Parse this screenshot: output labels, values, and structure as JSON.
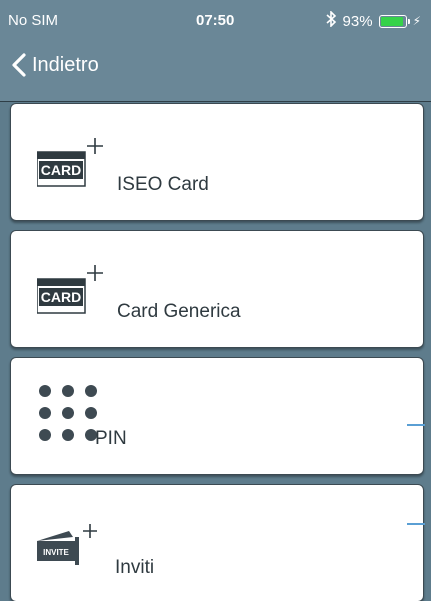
{
  "status_bar": {
    "carrier": "No SIM",
    "time": "07:50",
    "battery_percent": "93%",
    "battery_level": 0.93,
    "colors": {
      "battery": "#35d24a"
    }
  },
  "nav": {
    "back_label": "Indietro"
  },
  "items": [
    {
      "label": "ISEO Card",
      "icon": "card-plus-icon",
      "icon_text": "CARD"
    },
    {
      "label": "Card Generica",
      "icon": "card-plus-icon",
      "icon_text": "CARD"
    },
    {
      "label": "PIN",
      "icon": "keypad-dots-icon"
    },
    {
      "label": "Inviti",
      "icon": "invite-plus-icon",
      "icon_text": "INVITE"
    }
  ],
  "colors": {
    "bar": "#6a8797",
    "background": "#5e7c8c",
    "accent_line": "#5a9fd4",
    "text": "#2f3a40"
  }
}
